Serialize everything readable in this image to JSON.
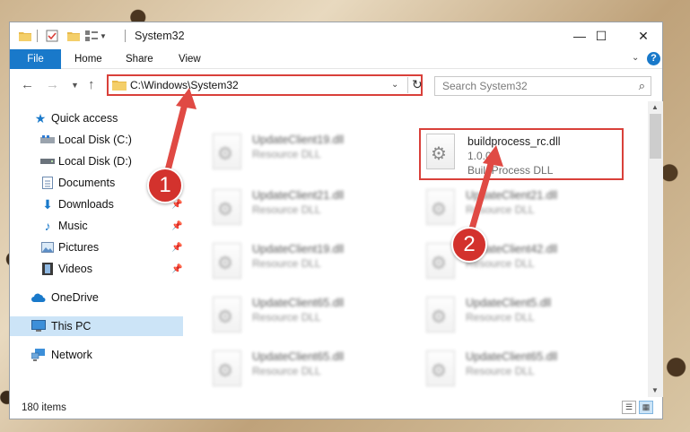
{
  "window": {
    "title": "System32",
    "minimize_glyph": "—",
    "maximize_glyph": "☐",
    "close_glyph": "✕"
  },
  "ribbon": {
    "tabs": [
      "File",
      "Home",
      "Share",
      "View"
    ],
    "help_glyph": "?"
  },
  "navigation": {
    "address": "C:\\Windows\\System32",
    "search_placeholder": "Search System32"
  },
  "sidebar": {
    "items": [
      {
        "label": "Quick access",
        "icon": "star-icon",
        "pinned": false
      },
      {
        "label": "Local Disk (C:)",
        "icon": "drive-icon",
        "pinned": false
      },
      {
        "label": "Local Disk (D:)",
        "icon": "drive-icon",
        "pinned": false
      },
      {
        "label": "Documents",
        "icon": "documents-icon",
        "pinned": true
      },
      {
        "label": "Downloads",
        "icon": "download-icon",
        "pinned": true
      },
      {
        "label": "Music",
        "icon": "music-icon",
        "pinned": true
      },
      {
        "label": "Pictures",
        "icon": "pictures-icon",
        "pinned": true
      },
      {
        "label": "Videos",
        "icon": "videos-icon",
        "pinned": true
      },
      {
        "label": "OneDrive",
        "icon": "cloud-icon",
        "pinned": false
      },
      {
        "label": "This PC",
        "icon": "computer-icon",
        "pinned": false
      },
      {
        "label": "Network",
        "icon": "network-icon",
        "pinned": false
      }
    ],
    "selected": "This PC"
  },
  "files": [
    {
      "name": "UpdateClient19.dll",
      "type": "Resource DLL",
      "blurred": true
    },
    {
      "name": "buildprocess_rc.dll",
      "version": "1.0.0.1",
      "type": "BuildProcess DLL",
      "blurred": false
    },
    {
      "name": "UpdateClient21.dll",
      "type": "Resource DLL",
      "blurred": true
    },
    {
      "name": "UpdateClient21.dll",
      "type": "Resource DLL",
      "blurred": true
    },
    {
      "name": "UpdateClient19.dll",
      "type": "Resource DLL",
      "blurred": true
    },
    {
      "name": "UpdateClient42.dll",
      "type": "Resource DLL",
      "blurred": true
    },
    {
      "name": "UpdateClient65.dll",
      "type": "Resource DLL",
      "blurred": true
    },
    {
      "name": "UpdateClient5.dll",
      "type": "Resource DLL",
      "blurred": true
    },
    {
      "name": "UpdateClient65.dll",
      "type": "Resource DLL",
      "blurred": true
    },
    {
      "name": "UpdateClient65.dll",
      "type": "Resource DLL",
      "blurred": true
    }
  ],
  "status": {
    "item_count": "180 items"
  },
  "annotations": {
    "marker_1": "1",
    "marker_2": "2",
    "highlight_color": "#d9403a",
    "arrow_color": "#e04a44"
  }
}
